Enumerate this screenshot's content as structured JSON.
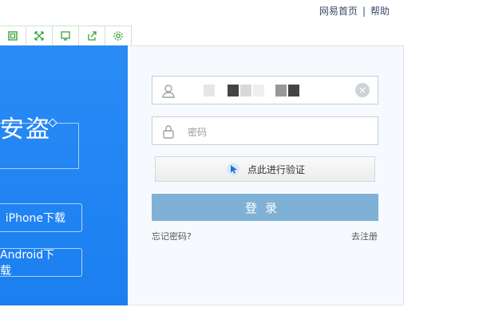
{
  "top_links": {
    "home": "网易首页",
    "separator": "|",
    "help": "帮助"
  },
  "toolbar": {
    "icons": [
      "restore-icon",
      "expand-icon",
      "screen-icon",
      "share-icon",
      "settings-icon"
    ]
  },
  "left_panel": {
    "headline": "安盗",
    "buttons": {
      "iphone": "iPhone下载",
      "android": "Android下载"
    }
  },
  "login_form": {
    "password_placeholder": "密码",
    "verify_label": "点此进行验证",
    "login_label": "登录",
    "forgot_label": "忘记密码?",
    "register_label": "去注册"
  },
  "colors": {
    "accent": "#2a8bf5",
    "login_button": "#7fb1d6"
  }
}
